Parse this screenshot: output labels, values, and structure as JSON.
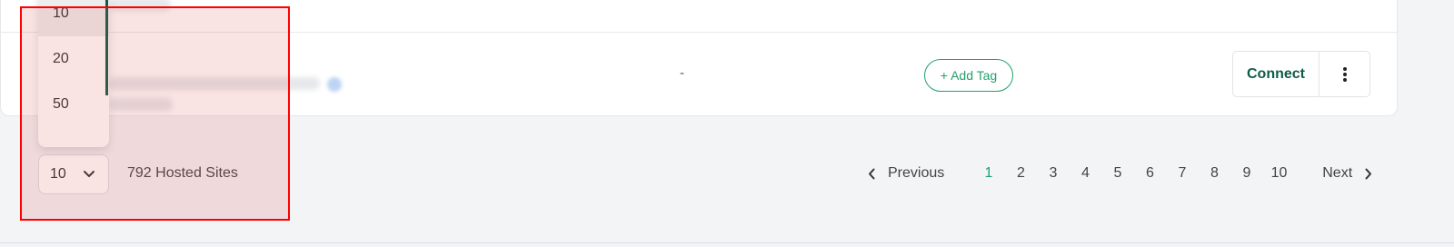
{
  "table": {
    "row": {
      "empty_value": "-",
      "add_tag_label": "+ Add Tag",
      "connect_label": "Connect"
    }
  },
  "footer": {
    "per_page_value": "10",
    "site_count": "792 Hosted Sites",
    "per_page_options": [
      "10",
      "20",
      "50"
    ]
  },
  "pagination": {
    "previous_label": "Previous",
    "next_label": "Next",
    "pages": [
      "1",
      "2",
      "3",
      "4",
      "5",
      "6",
      "7",
      "8",
      "9",
      "10"
    ],
    "current_page": "1"
  },
  "colors": {
    "accent": "#22a06b",
    "connect_text": "#0f5c4a",
    "highlight": "#ff0000"
  }
}
